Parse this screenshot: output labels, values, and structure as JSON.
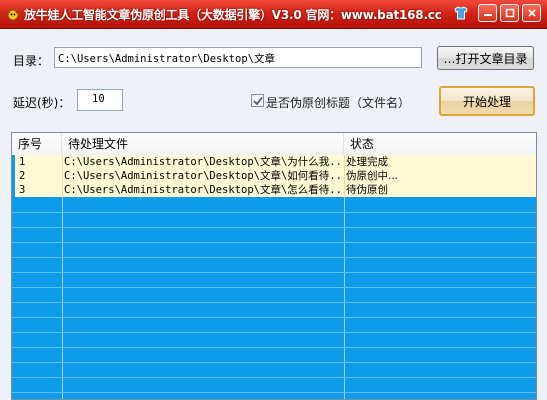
{
  "window": {
    "title": "放牛娃人工智能文章伪原创工具（大数据引擎）V3.0 官网：www.bat168.cc"
  },
  "form": {
    "dir_label": "目录：",
    "dir_value": "C:\\Users\\Administrator\\Desktop\\文章",
    "open_dir_button": "…打开文章目录",
    "delay_label": "延迟(秒)：",
    "delay_value": "10",
    "checkbox_label": "是否伪原创标题（文件名）",
    "checkbox_checked": true,
    "start_button": "开始处理"
  },
  "table": {
    "columns": [
      "序号",
      "待处理文件",
      "状态"
    ],
    "rows": [
      {
        "num": "1",
        "file": "C:\\Users\\Administrator\\Desktop\\文章\\为什么我...",
        "status": "处理完成"
      },
      {
        "num": "2",
        "file": "C:\\Users\\Administrator\\Desktop\\文章\\如何看待...",
        "status": "伪原创中..."
      },
      {
        "num": "3",
        "file": "C:\\Users\\Administrator\\Desktop\\文章\\怎么看待...",
        "status": "待伪原创"
      }
    ]
  },
  "colors": {
    "titlebar": "#d42418",
    "row_highlight": "#fff9d6",
    "empty_rows": "#0d9bea",
    "start_button_border": "#e0a43a"
  },
  "icons": {
    "app": "cow-head-icon",
    "skin": "skin-shirt-icon",
    "minimize": "minimize-icon",
    "maximize": "maximize-icon",
    "close": "close-icon",
    "check": "checkmark-icon"
  }
}
